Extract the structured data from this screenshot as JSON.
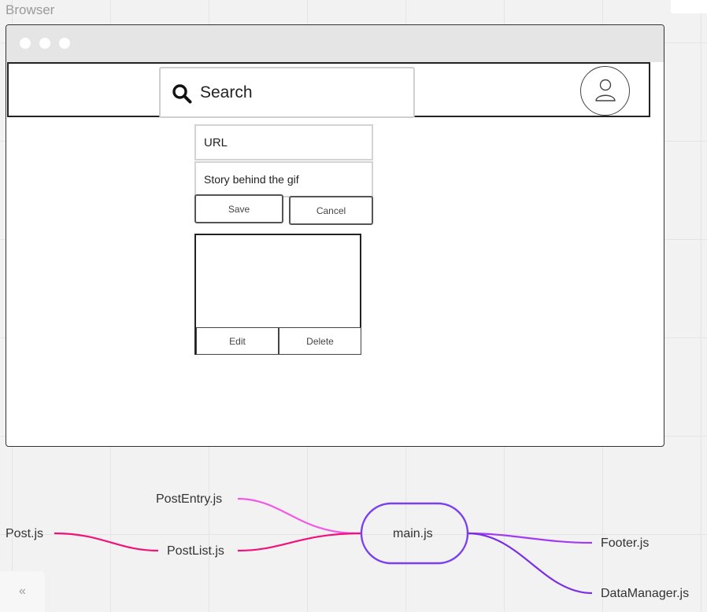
{
  "frame_label": "Browser",
  "header": {
    "search_placeholder": "Search"
  },
  "form": {
    "url_label": "URL",
    "story_label": "Story behind the gif",
    "save_label": "Save",
    "cancel_label": "Cancel"
  },
  "post_card": {
    "edit_label": "Edit",
    "delete_label": "Delete"
  },
  "mindmap": {
    "center": "main.js",
    "nodes": {
      "post_entry": "PostEntry.js",
      "post_list": "PostList.js",
      "post": "Post.js",
      "footer": "Footer.js",
      "data_manager": "DataManager.js"
    },
    "colors": {
      "center_border": "#7b3ff2",
      "pink": "#f25ae6",
      "magenta": "#f0127a",
      "violet": "#a33bf0",
      "purple": "#7a2ee6"
    }
  },
  "toolbar": {
    "collapse_label": "«"
  }
}
